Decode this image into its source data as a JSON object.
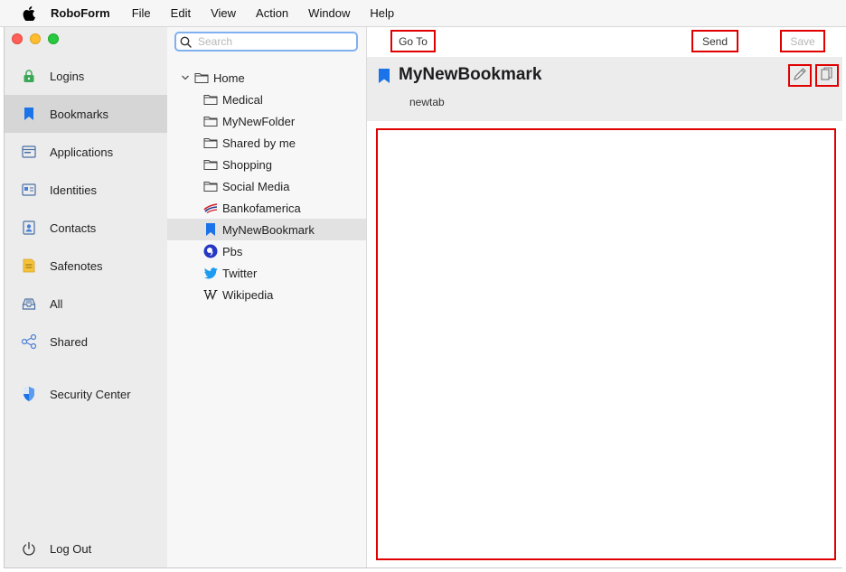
{
  "menubar": {
    "app_name": "RoboForm",
    "items": [
      "File",
      "Edit",
      "View",
      "Action",
      "Window",
      "Help"
    ]
  },
  "sidebar": {
    "items": [
      {
        "label": "Logins",
        "icon": "lock-icon"
      },
      {
        "label": "Bookmarks",
        "icon": "bookmark-icon",
        "active": true
      },
      {
        "label": "Applications",
        "icon": "application-icon"
      },
      {
        "label": "Identities",
        "icon": "identity-card-icon"
      },
      {
        "label": "Contacts",
        "icon": "contact-icon"
      },
      {
        "label": "Safenotes",
        "icon": "note-icon"
      },
      {
        "label": "All",
        "icon": "inbox-tray-icon"
      },
      {
        "label": "Shared",
        "icon": "share-icon"
      },
      {
        "label": "Security Center",
        "icon": "shield-icon"
      }
    ],
    "logout_label": "Log Out"
  },
  "tree": {
    "search_placeholder": "Search",
    "root": "Home",
    "children": [
      {
        "label": "Medical",
        "icon": "folder-icon"
      },
      {
        "label": "MyNewFolder",
        "icon": "folder-icon"
      },
      {
        "label": "Shared by me",
        "icon": "folder-icon"
      },
      {
        "label": "Shopping",
        "icon": "folder-icon"
      },
      {
        "label": "Social Media",
        "icon": "folder-icon"
      },
      {
        "label": "Bankofamerica",
        "icon": "bankofamerica-logo-icon"
      },
      {
        "label": "MyNewBookmark",
        "icon": "bookmark-icon",
        "selected": true
      },
      {
        "label": "Pbs",
        "icon": "pbs-logo-icon"
      },
      {
        "label": "Twitter",
        "icon": "twitter-bird-icon"
      },
      {
        "label": "Wikipedia",
        "icon": "wikipedia-w-icon"
      }
    ]
  },
  "toolbar": {
    "goto_label": "Go To",
    "send_label": "Send",
    "save_label": "Save"
  },
  "detail": {
    "title": "MyNewBookmark",
    "url": "newtab"
  },
  "colors": {
    "highlight_border": "#e00000",
    "accent_blue": "#1a73e8",
    "sidebar_bg": "#ececec"
  }
}
